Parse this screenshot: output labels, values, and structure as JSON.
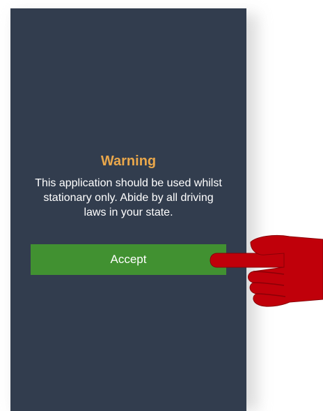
{
  "dialog": {
    "title": "Warning",
    "message": "This application should be used whilst stationary only. Abide by all driving laws in your state.",
    "accept_label": "Accept"
  },
  "icons": {
    "pointer": "pointing-hand-icon"
  },
  "colors": {
    "screen_background": "#323d4e",
    "title": "#e9a74b",
    "button": "#419131",
    "pointer": "#c0000a"
  }
}
